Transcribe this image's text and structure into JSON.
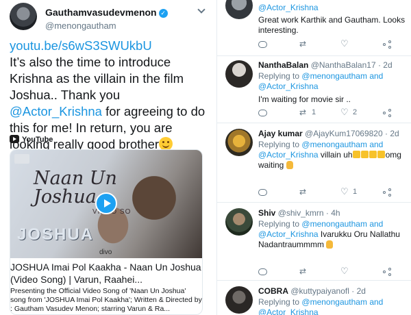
{
  "tweet": {
    "author_name": "Gauthamvasudevmenon",
    "author_handle": "@menongautham",
    "link": "youtu.be/s6wS3SWUkbU",
    "text_part1": "It’s also the time to introduce Krishna as the villain in the film  Joshua.. Thank you ",
    "mention": "@Actor_Krishna",
    "text_part2": " for agreeing to do this for me! In return, you are looking really good brother",
    "icons": {
      "verified": "verified-badge-icon",
      "emoji": "smiling-face-icon",
      "menu": "chevron-down-icon"
    }
  },
  "card": {
    "source": "YouTube",
    "thumb_title": "Naan Un Joshua",
    "thumb_subtitle": "VIDEO SO",
    "thumb_logo": "JOSHUA",
    "thumb_label": "divo",
    "title": "JOSHUA Imai Pol Kaakha - Naan Un Joshua (Video Song) | Varun, Raahei...",
    "description": "Presenting the Official Video Song of 'Naan Un Joshua' song from 'JOSHUA Imai Pol Kaakha'; Written & Directed by : Gautham Vasudev Menon; starring Varun & Ra...",
    "play_icon": "play-icon"
  },
  "replies": [
    {
      "name": "",
      "handle": "",
      "time": "",
      "replying": "",
      "mention_a": "@Actor_Krishna",
      "mention_b": "",
      "text": "Great work Karthik and Gautham. Looks interesting.",
      "reply_count": "",
      "rt_count": "",
      "like_count": ""
    },
    {
      "name": "NanthaBalan",
      "handle": "@NanthaBalan17",
      "time": "· 2d",
      "replying": "Replying to",
      "mention_a": "@menongautham",
      "and": "and",
      "mention_b": "@Actor_Krishna",
      "text": "I'm waiting for movie sir ..",
      "reply_count": "",
      "rt_count": "1",
      "like_count": "2"
    },
    {
      "name": "Ajay kumar",
      "handle": "@AjayKum17069820",
      "time": "· 2d",
      "replying": "Replying to",
      "mention_a": "@menongautham",
      "and": "and",
      "mention_b": "@Actor_Krishna",
      "text_a": " villain uh",
      "text_b": "omg waiting",
      "reply_count": "",
      "rt_count": "",
      "like_count": "1"
    },
    {
      "name": "Shiv",
      "handle": "@shiv_kmrn",
      "time": "· 4h",
      "replying": "Replying to",
      "mention_a": "@menongautham",
      "and": "and",
      "mention_b": "@Actor_Krishna",
      "text": " Ivarukku Oru Nallathu Nadantraummmm",
      "reply_count": "",
      "rt_count": "",
      "like_count": ""
    },
    {
      "name": "COBRA",
      "handle": "@kuttypaiyanofl",
      "time": "· 2d",
      "replying": "Replying to",
      "mention_a": "@menongautham",
      "and": "and",
      "mention_b": "@Actor_Krishna"
    }
  ],
  "icons": {
    "reply": "reply-icon",
    "retweet": "retweet-icon",
    "like": "heart-icon",
    "share": "share-icon"
  },
  "colors": {
    "link": "#1b95e0",
    "muted": "#657786",
    "verified": "#1da1f2"
  }
}
